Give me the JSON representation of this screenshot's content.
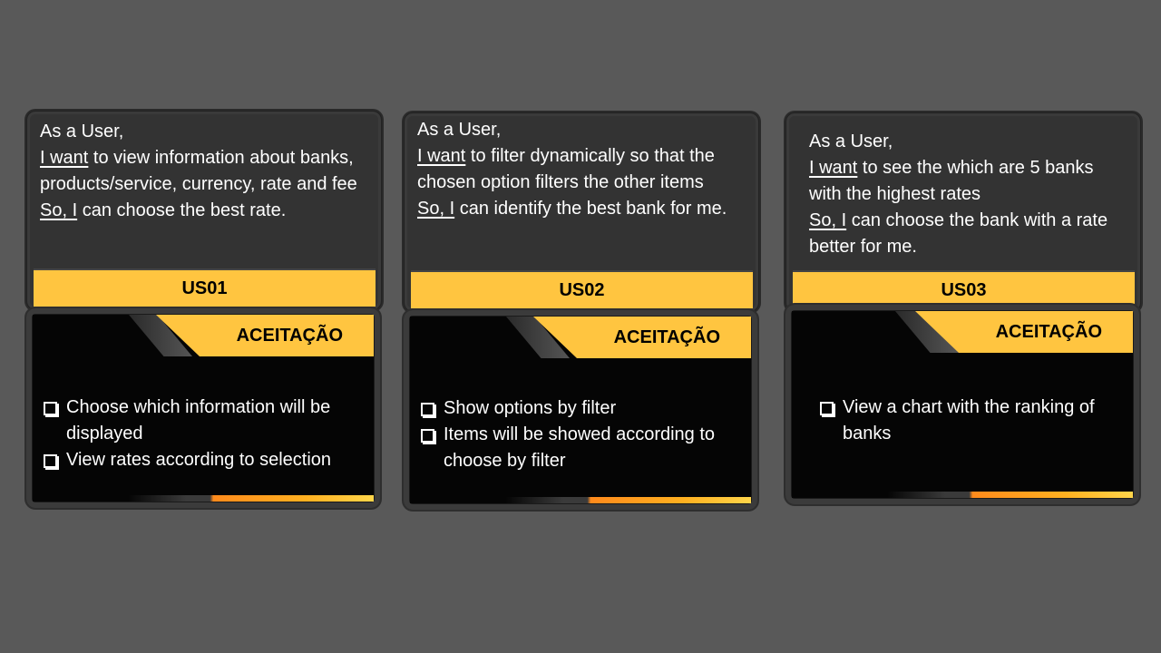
{
  "cards": [
    {
      "story": {
        "role": "As a User,",
        "want_label": "I want",
        "want_text": " to view information about banks, products/service, currency, rate and fee",
        "so_label": "So, I",
        "so_text": " can choose the best rate."
      },
      "title": "US01",
      "acceptance_label": "ACEITAÇÃO",
      "criteria": [
        "Choose which information will be displayed",
        "View rates according to selection"
      ]
    },
    {
      "story": {
        "role": "As a User,",
        "want_label": "I want",
        "want_text": " to filter dynamically so that the chosen option filters the other items",
        "so_label": "So, I",
        "so_text": " can identify the best bank for me."
      },
      "title": "US02",
      "acceptance_label": "ACEITAÇÃO",
      "criteria": [
        "Show options by filter",
        "Items will be showed according to choose by filter"
      ]
    },
    {
      "story": {
        "role": "As a User,",
        "want_label": "I want",
        "want_text": " to see the which are 5 banks with the highest rates",
        "so_label": "So, I",
        "so_text": " can choose the bank with a rate better for me."
      },
      "title": "US03",
      "acceptance_label": "ACEITAÇÃO",
      "criteria": [
        "View a chart with the ranking of banks"
      ]
    }
  ],
  "colors": {
    "background": "#595959",
    "accent": "#ffc540",
    "panel": "#333333",
    "acceptance_bg": "#050505"
  },
  "icons": [
    "checkbox-icon"
  ]
}
